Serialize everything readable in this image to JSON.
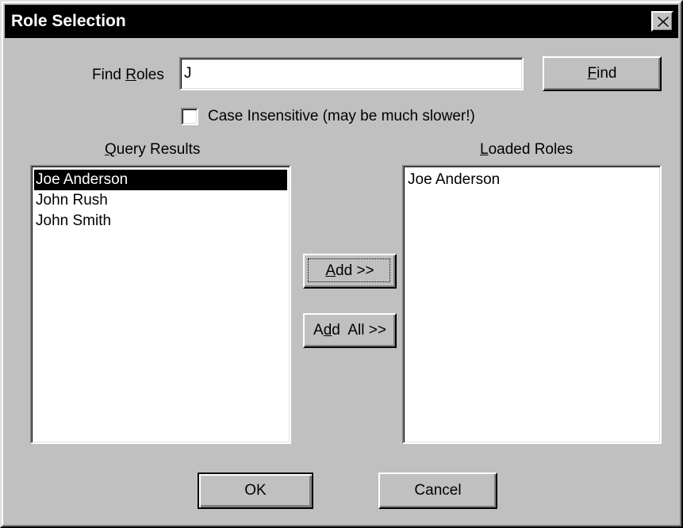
{
  "window": {
    "title": "Role Selection",
    "close_symbol": "close-icon"
  },
  "find": {
    "label_prefix": "Find ",
    "label_mnemonic": "R",
    "label_rest": "oles",
    "value": "J",
    "button_mnemonic": "F",
    "button_rest": "ind"
  },
  "case_insensitive": {
    "label": "Case Insensitive (may be much slower!)",
    "checked": false
  },
  "query_results": {
    "header_mnemonic": "Q",
    "header_rest": "uery Results",
    "items": [
      {
        "label": "Joe Anderson",
        "selected": true
      },
      {
        "label": "John Rush",
        "selected": false
      },
      {
        "label": "John Smith",
        "selected": false
      }
    ]
  },
  "loaded_roles": {
    "header_mnemonic": "L",
    "header_rest": "oaded Roles",
    "items": [
      {
        "label": "Joe Anderson",
        "selected": false
      }
    ]
  },
  "transfer": {
    "add_mnemonic": "A",
    "add_rest": "dd >>",
    "add_all_prefix": "A",
    "add_all_mnemonic": "d",
    "add_all_rest": "d  All >>"
  },
  "footer": {
    "ok_label": "OK",
    "cancel_label": "Cancel"
  }
}
